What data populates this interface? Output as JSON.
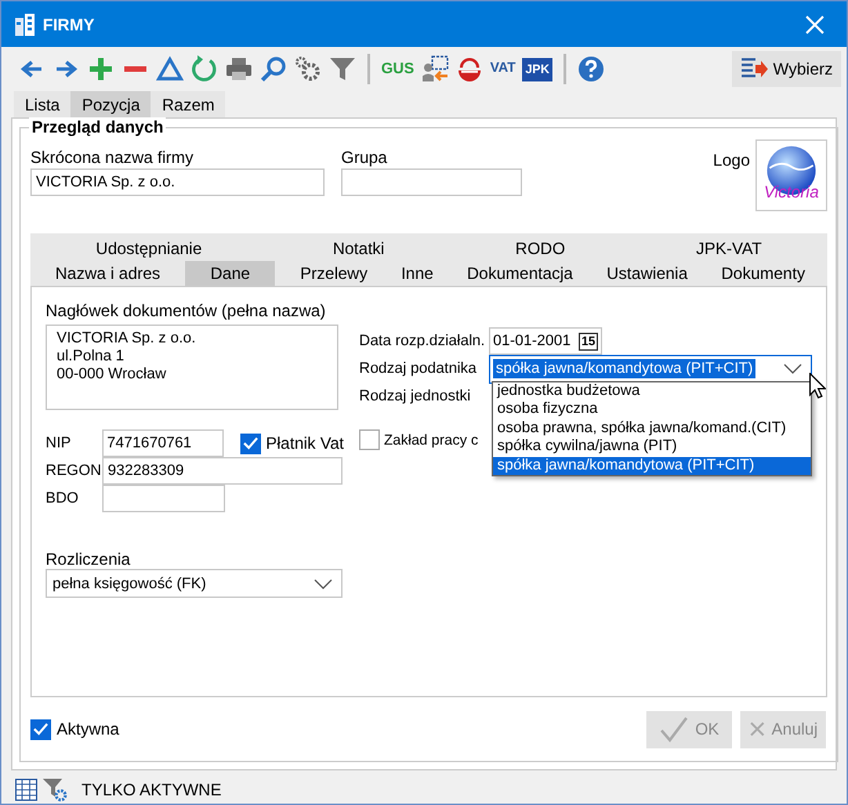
{
  "window": {
    "title": "FIRMY"
  },
  "toolbar": [
    {
      "kind": "back"
    },
    {
      "kind": "forward"
    },
    {
      "kind": "add"
    },
    {
      "kind": "remove"
    },
    {
      "kind": "delta"
    },
    {
      "kind": "refresh"
    },
    {
      "kind": "print"
    },
    {
      "kind": "search"
    },
    {
      "kind": "gears"
    },
    {
      "kind": "filter"
    },
    {
      "kind": "separator"
    },
    {
      "kind": "gus",
      "text": "GUS"
    },
    {
      "kind": "import"
    },
    {
      "kind": "stamp"
    },
    {
      "kind": "vat",
      "text": "VAT"
    },
    {
      "kind": "jpk",
      "text": "JPK"
    },
    {
      "kind": "separator"
    },
    {
      "kind": "help"
    }
  ],
  "select_button": "Wybierz",
  "tabs": [
    {
      "label": "Lista",
      "selected": false
    },
    {
      "label": "Pozycja",
      "selected": true
    },
    {
      "label": "Razem",
      "selected": false
    }
  ],
  "group": {
    "title": "Przegląd danych"
  },
  "short_name": {
    "label": "Skrócona nazwa firmy",
    "value": "VICTORIA Sp. z o.o."
  },
  "group_field": {
    "label": "Grupa"
  },
  "logo": {
    "label": "Logo",
    "text": "Victoria"
  },
  "inner_tab_rows": [
    {
      "tabs": [
        {
          "label": "Udostępnianie",
          "selected": false
        },
        {
          "label": "Notatki",
          "selected": false
        },
        {
          "label": "RODO",
          "selected": false
        },
        {
          "label": "JPK-VAT",
          "selected": false
        }
      ]
    },
    {
      "tabs": [
        {
          "label": "Nazwa i adres",
          "selected": false
        },
        {
          "label": "Dane",
          "selected": true
        },
        {
          "label": "Przelewy",
          "selected": false
        },
        {
          "label": "Inne",
          "selected": false
        },
        {
          "label": "Dokumentacja",
          "selected": false
        },
        {
          "label": "Ustawienia",
          "selected": false
        },
        {
          "label": "Dokumenty",
          "selected": false
        }
      ]
    }
  ],
  "header": {
    "label": "Nagłówek dokumentów (pełna nazwa)",
    "lines": [
      "VICTORIA Sp. z o.o.",
      "ul.Polna 1",
      "00-000 Wrocław"
    ]
  },
  "nip": {
    "label": "NIP",
    "value": "7471670761"
  },
  "vat_payer": {
    "label": "Płatnik Vat",
    "checked": true
  },
  "regon": {
    "label": "REGON",
    "value": "932283309"
  },
  "bdo": {
    "label": "BDO"
  },
  "settlement": {
    "label": "Rozliczenia",
    "value": "pełna księgowość (FK)"
  },
  "start_date": {
    "label": "Data rozp.działaln.",
    "value": "01-01-2001",
    "calendar_text": "15"
  },
  "taxpayer_type": {
    "label": "Rodzaj podatnika",
    "value": "spółka jawna/komandytowa (PIT+CIT)",
    "expanded": true,
    "options": [
      {
        "label": "jednostka budżetowa",
        "selected": false
      },
      {
        "label": "osoba fizyczna",
        "selected": false
      },
      {
        "label": "osoba prawna, spółka jawna/komand.(CIT)",
        "selected": false
      },
      {
        "label": "spółka cywilna/jawna (PIT)",
        "selected": false
      },
      {
        "label": "spółka jawna/komandytowa (PIT+CIT)",
        "selected": true
      }
    ]
  },
  "unit_type": {
    "label": "Rodzaj jednostki"
  },
  "workplace": {
    "label": "Zakład pracy c",
    "checked": false
  },
  "active": {
    "label": "Aktywna",
    "checked": true
  },
  "buttons": [
    {
      "kind": "ok",
      "label": "OK",
      "disabled": true
    },
    {
      "kind": "cancel",
      "label": "Anuluj",
      "disabled": true
    }
  ],
  "status_bar": {
    "text": "TYLKO AKTYWNE"
  }
}
